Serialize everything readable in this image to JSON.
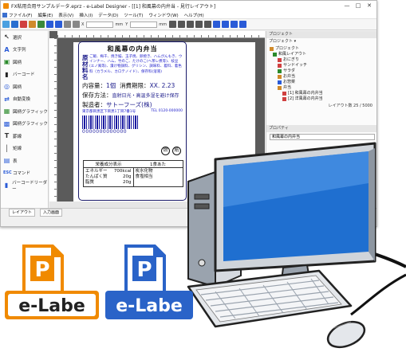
{
  "window": {
    "title": "FX粘用合用サンプルデータ.eprz - e-Label Designer - [[1] 和風幕の内弁当 - 見行レイアウト]",
    "controls": [
      "—",
      "□",
      "✕"
    ]
  },
  "menu": [
    "ファイル(F)",
    "編集(E)",
    "表示(V)",
    "挿入(I)",
    "データ(D)",
    "ツール(T)",
    "ウィンドウ(W)",
    "ヘルプ(H)"
  ],
  "toolbar": {
    "x_unit": "mm",
    "y_unit": "mm",
    "x_label": "X",
    "y_label": "Y"
  },
  "tools": [
    {
      "label": "選択",
      "icon": "cursor-icon",
      "glyph": "↖",
      "color": "#333333"
    },
    {
      "label": "文字列",
      "icon": "text-icon",
      "glyph": "A",
      "color": "#2a5bd7"
    },
    {
      "label": "図柄",
      "icon": "image-icon",
      "glyph": "▣",
      "color": "#2a8a2a"
    },
    {
      "label": "バーコード",
      "icon": "barcode-icon",
      "glyph": "▮",
      "color": "#222222"
    },
    {
      "label": "図柄",
      "icon": "shape-icon",
      "glyph": "◎",
      "color": "#2a5bd7"
    },
    {
      "label": "自動変換",
      "icon": "convert-icon",
      "glyph": "⇄",
      "color": "#2a5bd7"
    },
    {
      "label": "図柄グラフィック",
      "icon": "graphic-icon",
      "glyph": "▦",
      "color": "#2a8a2a"
    },
    {
      "label": "図柄グラフィック",
      "icon": "graphic2-icon",
      "glyph": "▩",
      "color": "#2a5bd7"
    },
    {
      "label": "罫線",
      "icon": "line-icon",
      "glyph": "T",
      "color": "#333333"
    },
    {
      "label": "矩線",
      "icon": "rect-icon",
      "glyph": "│",
      "color": "#333333"
    },
    {
      "label": "表",
      "icon": "table-icon",
      "glyph": "▤",
      "color": "#2a5bd7"
    },
    {
      "label": "コマンド",
      "icon": "command-icon",
      "glyph": "ESC",
      "color": "#2a5bd7"
    },
    {
      "label": "バーコードリーダー",
      "icon": "reader-icon",
      "glyph": "▮",
      "color": "#2a5bd7"
    }
  ],
  "label": {
    "title": "和風幕の内弁当",
    "raw_head": "原材料名",
    "raw_text": "ご飯、梅干、焼き鮭、玉子焼、卵焼き、ハムがんもき、ウインナー、ハム、竹のこ、たけのこ(ヘ茶レ煮等)、枝豆(エノ風等)、漬け物調料、グリシン、調味料、着料、着色料（カラメル、カロテノイド）、保存料(溶液)",
    "content_label": "内容量：",
    "content_value": "1個",
    "expiry_label": "消費期限：",
    "expiry_value": "XX. 2.23",
    "storage_label": "保存方法：",
    "storage_value": "直射日光・高温多湿を避け保存",
    "maker_label": "製造者：",
    "maker_value": "サトーフーズ(株)",
    "address": "東京都目黒区下目黒1丁目7番1号",
    "tel": "TEL 0120-000000",
    "barcode_number": "0000000000000",
    "marks": [
      "燃",
      "紙"
    ],
    "nutrition_title": "栄養成分表示",
    "nutrition_per": "1食あた",
    "nutrition_rows": [
      {
        "name": "エネルギー",
        "value": "700kcal"
      },
      {
        "name": "たんぱく質",
        "value": "20g"
      },
      {
        "name": "脂質",
        "value": "20g"
      }
    ],
    "nutrition_right": [
      "炭水化物",
      "食塩相当"
    ]
  },
  "project_panel": {
    "title": "プロジェクト",
    "sub": "プロジェクト ▾",
    "tree": [
      "プロジェクト",
      "和風レイアウト",
      "おにぎり",
      "サンドイッチ",
      "サラダ",
      "お弁当",
      "お惣菜",
      "弁当",
      "[1] 和風幕の内弁当",
      "[2] 洋風幕の内弁当"
    ],
    "layout_count": "レイアウト数 25 / 5000"
  },
  "prop_panel": {
    "title": "プロパティ",
    "field": "和風幕の内弁当"
  },
  "status": {
    "tab1": "レイアウト",
    "tab2": "入力画面"
  },
  "logos": {
    "orange": {
      "letter": "P",
      "text": "e-Labe",
      "color": "#f08a00"
    },
    "blue": {
      "letter": "P",
      "text": "e-Labe",
      "color": "#2a63c8"
    }
  },
  "colors": {
    "label_border": "#1a1a6a",
    "label_text": "#1a1a8a",
    "monitor_screen": "#1f6fd0",
    "monitor_body": "#c9ced6",
    "orange_logo": "#f08a00",
    "blue_logo": "#2a63c8"
  }
}
